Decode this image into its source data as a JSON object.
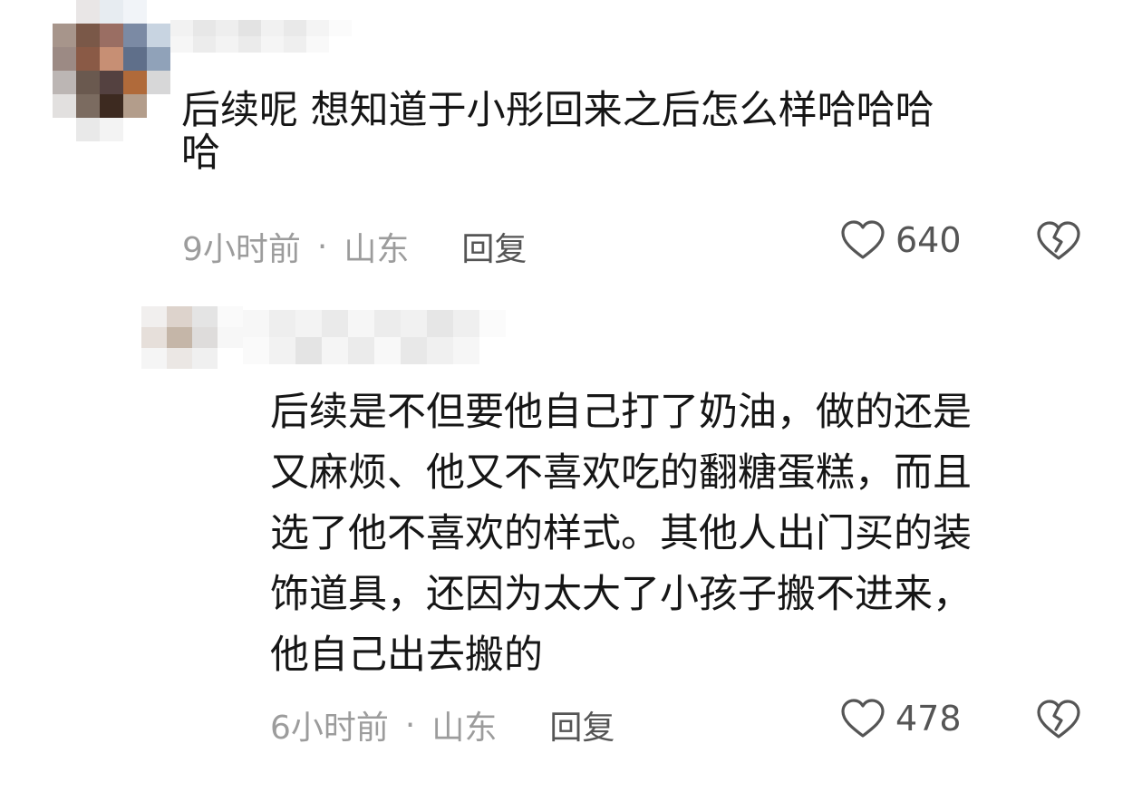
{
  "comments": [
    {
      "text_lines": [
        "后续呢 想知道于小彤回来之后怎么样哈哈哈",
        "哈"
      ],
      "time": "9小时前",
      "separator": "·",
      "location": "山东",
      "reply_label": "回复",
      "likes": "640",
      "like_icon": "heart-outline-icon",
      "dislike_icon": "broken-heart-icon"
    },
    {
      "text_lines": [
        "后续是不但要他自己打了奶油，做的还是",
        "又麻烦、他又不喜欢吃的翻糖蛋糕，而且",
        "选了他不喜欢的样式。其他人出门买的装",
        "饰道具，还因为太大了小孩子搬不进来，",
        "他自己出去搬的"
      ],
      "time": "6小时前",
      "separator": "·",
      "location": "山东",
      "reply_label": "回复",
      "likes": "478",
      "like_icon": "heart-outline-icon",
      "dislike_icon": "broken-heart-icon"
    }
  ],
  "colors": {
    "text": "#161616",
    "meta": "#9c9c9c",
    "reply": "#555555",
    "icon_stroke": "#555555"
  }
}
